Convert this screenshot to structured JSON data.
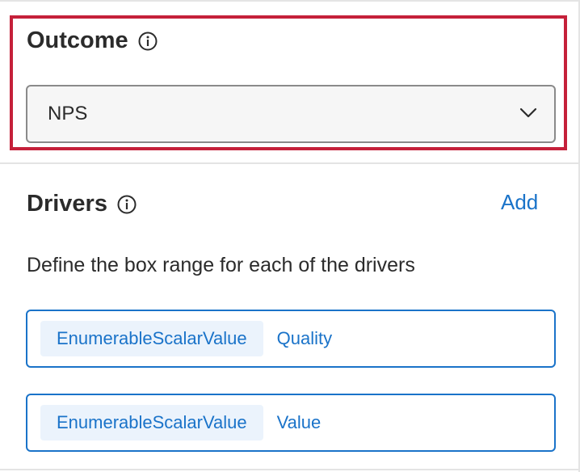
{
  "outcome": {
    "title": "Outcome",
    "info_icon": "info-icon",
    "select": {
      "value": "NPS",
      "icon": "chevron-down-icon"
    },
    "highlight_color": "#c5203a"
  },
  "drivers": {
    "title": "Drivers",
    "info_icon": "info-icon",
    "add_label": "Add",
    "description": "Define the box range for each of the drivers",
    "items": [
      {
        "type": "EnumerableScalarValue",
        "name": "Quality"
      },
      {
        "type": "EnumerableScalarValue",
        "name": "Value"
      }
    ]
  },
  "colors": {
    "accent": "#1a73c9",
    "chip_bg": "#ebf3fc",
    "text": "#2b2b2b"
  }
}
